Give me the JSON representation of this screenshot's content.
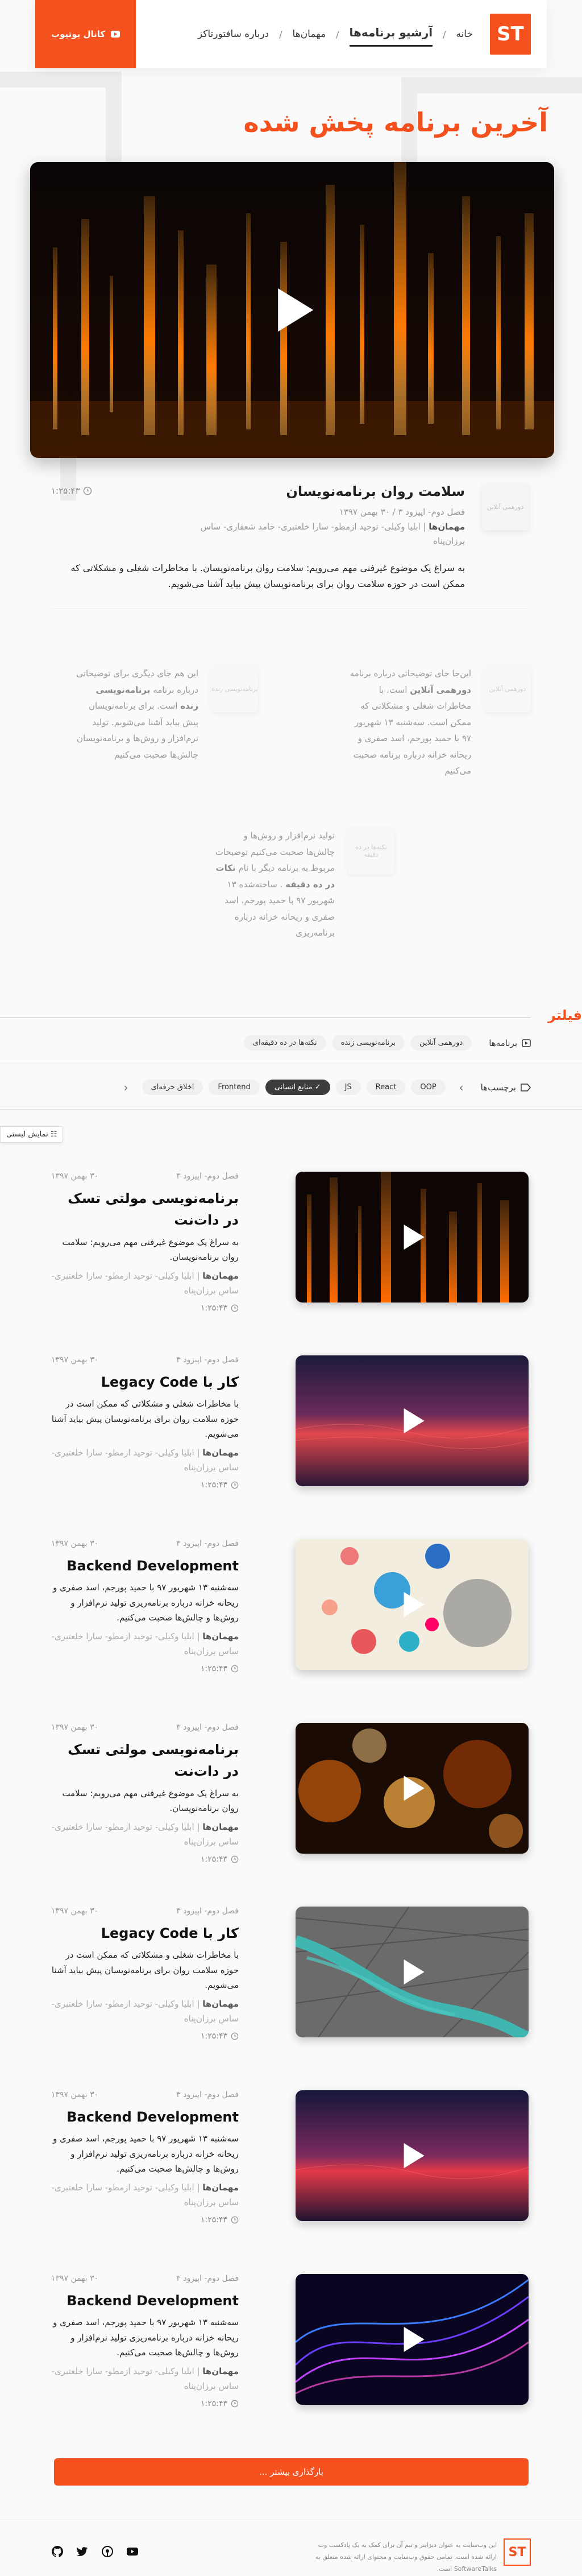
{
  "header": {
    "logo": "ST",
    "nav": [
      {
        "label": "خانه",
        "active": false
      },
      {
        "label": "آرشیو برنامه‌ها",
        "active": true
      },
      {
        "label": "مهمان‌ها",
        "active": false
      },
      {
        "label": "درباره سافتورتاکز",
        "active": false
      }
    ],
    "youtube_label": "کانال یوتیوب"
  },
  "hero": {
    "title": "آخرین برنامه پخش شده"
  },
  "featured": {
    "thumb_label": "دورهمی آنلاین",
    "title": "سلامت روان برنامه‌نویسان",
    "duration": "۱:۲۵:۴۳",
    "episode": "فصل دوم- اپیزود ۳ / ۳۰ بهمن ۱۳۹۷",
    "guests_label": "مهمان‌ها",
    "guests": "| ابلیا وکیلی- توحید ازمطو- سارا خلعتبری- حامد شعفاری- ساس",
    "guests2": "برزان‌پناه",
    "description": "به سراغ یک موضوع غیرفنی مهم می‌رویم: سلامت روان برنامه‌نویسان. با مخاطرات شغلی و مشکلاتی که ممکن است در حوزه سلامت روان برای برنامه‌نویسان پیش بیاید آشنا می‌شویم."
  },
  "related": [
    {
      "thumb": "دورهمی آنلاین",
      "text": "این‌جا جای توضیحاتی درباره برنامه",
      "bold": "دورهمی آنلاین",
      "rest": "است. با مخاطرات شغلی و مشکلاتی که ممکن است. سه‌شنبه ۱۳ شهریور ۹۷ با حمید پورجم، اسد صفری و ریحانه خزانه درباره برنامه صحبت می‌کنیم"
    },
    {
      "thumb": "برنامه‌نویسی زنده",
      "text": "این هم جای دیگری برای توضیحاتی درباره برنامه",
      "bold": "برنامه‌نویسی زنده",
      "rest": "است. برای برنامه‌نویسان پیش بیاید آشنا می‌شویم. تولید نرم‌افزار و روش‌ها و برنامه‌نویسان چالش‌ها صحبت می‌کنیم"
    },
    {
      "thumb": "نکته‌ها در ده دقیقه",
      "text": "تولید نرم‌افزار و روش‌ها و چالش‌ها صحبت می‌کنیم توضیحات مربوط به برنامه دیگر با نام",
      "bold": "نکات در ده دقیقه",
      "rest": ". ساخته‌شده ۱۳ شهریور ۹۷ با حمید پورجم، اسد صفری و ریحانه خزانه درباره برنامه‌ریزی"
    }
  ],
  "filters": {
    "title": "فیلتر",
    "programs_label": "برنامه‌ها",
    "programs": [
      "دورهمی آنلاین",
      "برنامه‌نویسی زنده",
      "نکته‌ها در ده دقیقه‌ای"
    ],
    "tags_label": "برچسب‌ها",
    "tags": [
      {
        "label": "OOP",
        "selected": false
      },
      {
        "label": "React",
        "selected": false
      },
      {
        "label": "JS",
        "selected": false
      },
      {
        "label": "منابع انسانی",
        "selected": true
      },
      {
        "label": "Frontend",
        "selected": false
      },
      {
        "label": "اخلاق حرفه‌ای",
        "selected": false
      }
    ],
    "live_label": "نمایش لیستی"
  },
  "cards": [
    {
      "episode": "فصل دوم- اپیزود ۳",
      "date": "۳۰ بهمن ۱۳۹۷",
      "title": "برنامه‌نویسی مولتی تسک در دات‌نت",
      "desc": "به سراغ یک موضوع غیرفنی مهم می‌رویم: سلامت روان برنامه‌نویسان.",
      "guests_label": "مهمان‌ها",
      "guests": "| ابلیا وکیلی- توحید ازمطو- سارا خلعتبری- ساس برزان‌پناه",
      "duration": "۱:۲۵:۴۳",
      "theme": "orange"
    },
    {
      "episode": "فصل دوم- اپیزود ۳",
      "date": "۳۰ بهمن ۱۳۹۷",
      "title": "کار با Legacy Code",
      "desc": "با مخاطرات شغلی و مشکلاتی که ممکن است در حوزه سلامت روان برای برنامه‌نویسان پیش بیاید آشنا می‌شویم.",
      "guests_label": "مهمان‌ها",
      "guests": "| ابلیا وکیلی- توحید ازمطو- سارا خلعتبری- ساس برزان‌پناه",
      "duration": "۱:۲۵:۴۳",
      "theme": "sunset"
    },
    {
      "episode": "فصل دوم- اپیزود ۳",
      "date": "۳۰ بهمن ۱۳۹۷",
      "title": "Backend Development",
      "desc": "سه‌شنبه ۱۳ شهریور ۹۷ با حمید پورجم، اسد صفری و ریحانه خزانه درباره برنامه‌ریزی تولید نرم‌افزار و روش‌ها و چالش‌ها صحبت می‌کنیم.",
      "guests_label": "مهمان‌ها",
      "guests": "| ابلیا وکیلی- توحید ازمطو- سارا خلعتبری- ساس برزان‌پناه",
      "duration": "۱:۲۵:۴۳",
      "theme": "balls"
    },
    {
      "episode": "فصل دوم- اپیزود ۳",
      "date": "۳۰ بهمن ۱۳۹۷",
      "title": "برنامه‌نویسی مولتی تسک در دات‌نت",
      "desc": "به سراغ یک موضوع غیرفنی مهم می‌رویم: سلامت روان برنامه‌نویسان.",
      "guests_label": "مهمان‌ها",
      "guests": "| ابلیا وکیلی- توحید ازمطو- سارا خلعتبری- ساس برزان‌پناه",
      "duration": "۱:۲۵:۴۳",
      "theme": "bokeh"
    },
    {
      "episode": "فصل دوم- اپیزود ۳",
      "date": "۳۰ بهمن ۱۳۹۷",
      "title": "کار با Legacy Code",
      "desc": "با مخاطرات شغلی و مشکلاتی که ممکن است در حوزه سلامت روان برای برنامه‌نویسان پیش بیاید آشنا می‌شویم.",
      "guests_label": "مهمان‌ها",
      "guests": "| ابلیا وکیلی- توحید ازمطو- سارا خلعتبری- ساس برزان‌پناه",
      "duration": "۱:۲۵:۴۳",
      "theme": "river"
    },
    {
      "episode": "فصل دوم- اپیزود ۳",
      "date": "۳۰ بهمن ۱۳۹۷",
      "title": "Backend Development",
      "desc": "سه‌شنبه ۱۳ شهریور ۹۷ با حمید پورجم، اسد صفری و ریحانه خزانه درباره برنامه‌ریزی تولید نرم‌افزار و روش‌ها و چالش‌ها صحبت می‌کنیم.",
      "guests_label": "مهمان‌ها",
      "guests": "| ابلیا وکیلی- توحید ازمطو- سارا خلعتبری- ساس برزان‌پناه",
      "duration": "۱:۲۵:۴۳",
      "theme": "sunset2"
    },
    {
      "episode": "فصل دوم- اپیزود ۳",
      "date": "۳۰ بهمن ۱۳۹۷",
      "title": "Backend Development",
      "desc": "سه‌شنبه ۱۳ شهریور ۹۷ با حمید پورجم، اسد صفری و ریحانه خزانه درباره برنامه‌ریزی تولید نرم‌افزار و روش‌ها و چالش‌ها صحبت می‌کنیم.",
      "guests_label": "مهمان‌ها",
      "guests": "| ابلیا وکیلی- توحید ازمطو- سارا خلعتبری- ساس برزان‌پناه",
      "duration": "۱:۲۵:۴۳",
      "theme": "neon"
    }
  ],
  "load_more": "بارگذاری بیشتر ...",
  "footer": {
    "logo": "ST",
    "text": "این وب‌سایت به عنوان دیزاینر و تیم آن برای کمک به یک پادکست وب ارائه شده است. تمامی حقوق وب‌سایت و محتوای ارائه شده متعلق به SoftwareTalks است.",
    "social": [
      "github-icon",
      "twitter-icon",
      "podcast-icon",
      "youtube-icon"
    ]
  },
  "colors": {
    "accent": "#f4511e",
    "dark": "#222222"
  }
}
